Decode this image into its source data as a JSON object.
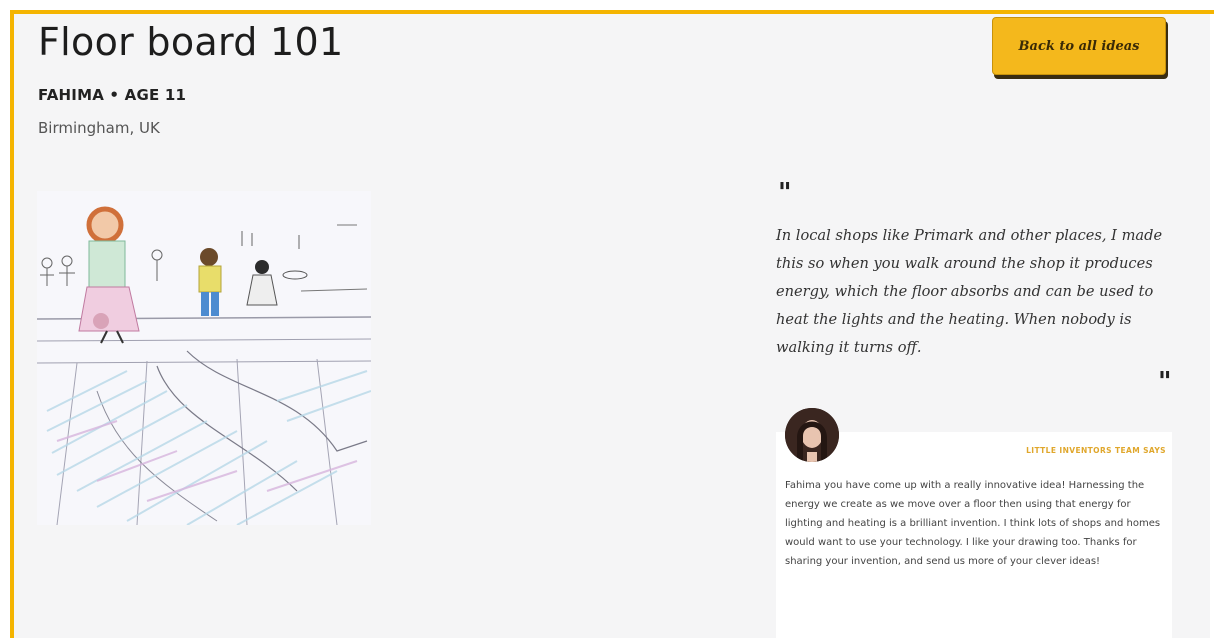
{
  "idea": {
    "title": "Floor board 101",
    "author": "FAHIMA • AGE 11",
    "location": "Birmingham, UK"
  },
  "nav": {
    "back_label": "Back to all ideas"
  },
  "quote": {
    "open_mark": "\"",
    "close_mark": "\"",
    "text": "In local shops like Primark and other places, I made this so when you walk around the shop it produces energy, which the floor absorbs and can be used to heat the lights and the heating. When nobody is walking it turns off."
  },
  "team": {
    "label": "LITTLE INVENTORS TEAM SAYS",
    "comment": "Fahima you have come up with a really innovative idea! Harnessing the energy we create as we move over a floor then using that energy for lighting and heating is a brilliant invention. I think lots of shops and homes would want to use your technology. I like your drawing too. Thanks for sharing your invention, and send us more of your clever ideas!"
  },
  "colors": {
    "accent": "#f4b400",
    "button": "#f4b81c",
    "background": "#f5f5f6",
    "team_label": "#e0a72c"
  }
}
